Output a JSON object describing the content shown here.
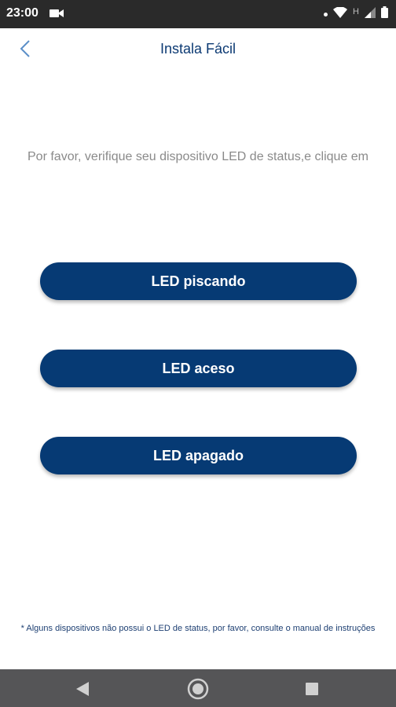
{
  "status_bar": {
    "time": "23:00",
    "network_indicator": "H"
  },
  "header": {
    "title": "Instala Fácil",
    "back_icon": "chevron-left-icon"
  },
  "main": {
    "instruction": "Por favor, verifique seu dispositivo LED de status,e clique em",
    "buttons": [
      {
        "label": "LED piscando"
      },
      {
        "label": "LED aceso"
      },
      {
        "label": "LED apagado"
      }
    ],
    "footnote": "* Alguns dispositivos não possui o LED de status, por favor, consulte o manual de instruções"
  },
  "colors": {
    "primary": "#063a74",
    "title": "#0c3a73",
    "instruction_text": "#8a8a8a",
    "status_bar": "#2a2a2a",
    "nav_bar": "#555557"
  }
}
